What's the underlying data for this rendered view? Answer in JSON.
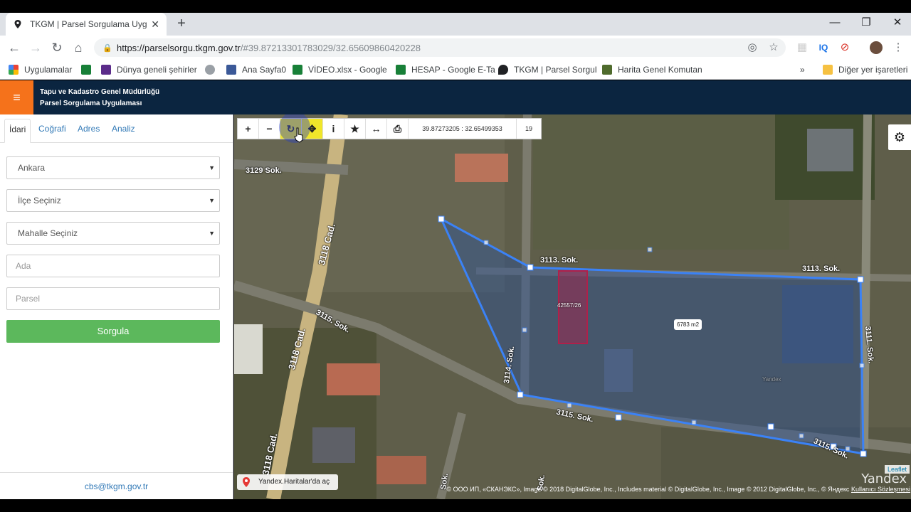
{
  "browser": {
    "tab_title": "TKGM | Parsel Sorgulama Uygula",
    "url_host": "https://parselsorgu.tkgm.gov.tr",
    "url_path": "/#39.87213301783029/32.65609860420228",
    "bookmarks": [
      "Uygulamalar",
      "Dünya geneli şehirler",
      "Ana Sayfa0",
      "VİDEO.xlsx - Google",
      "HESAP - Google E-Ta",
      "TKGM | Parsel Sorgul",
      "Harita Genel Komutan",
      "Diğer yer işaretleri"
    ]
  },
  "header": {
    "line1": "Tapu ve Kadastro Genel Müdürlüğü",
    "line2": "Parsel Sorgulama Uygulaması",
    "menu_icon": "hamburger-icon"
  },
  "sidebar": {
    "tabs": [
      "İdari",
      "Coğrafi",
      "Adres",
      "Analiz"
    ],
    "il": "Ankara",
    "ilce": "İlçe Seçiniz",
    "mahalle": "Mahalle Seçiniz",
    "ada_placeholder": "Ada",
    "parsel_placeholder": "Parsel",
    "submit": "Sorgula",
    "footer_email": "cbs@tkgm.gov.tr"
  },
  "map": {
    "coordinates": "39.87273205 : 32.65499353",
    "zoom": "19",
    "area_label": "6783 m2",
    "parcel_label": "42557/26",
    "street_labels": [
      "3129 Sok.",
      "3118 Cad.",
      "3118 Cad.",
      "3118 Cad.",
      "3113. Sok.",
      "3113. Sok.",
      "3115. Sok.",
      "3114. Sok.",
      "3115. Sok.",
      "3115. Sok.",
      "3111. Sok.",
      "Sok.",
      "Sok."
    ],
    "yandex_open": "Yandex.Haritalar'da aç",
    "attribution": "© ООО ИП, «СКАНЭКС», Image © 2018 DigitalGlobe, Inc., Includes material © DigitalGlobe, Inc., Image © 2012 DigitalGlobe, Inc., © Яндекс",
    "terms": "Kullanıcı Sözleşmesi",
    "leaflet": "Leaflet",
    "watermark": "Yandex",
    "accent_polygon": "#3b82f6",
    "accent_parcel": "#b0204a"
  }
}
